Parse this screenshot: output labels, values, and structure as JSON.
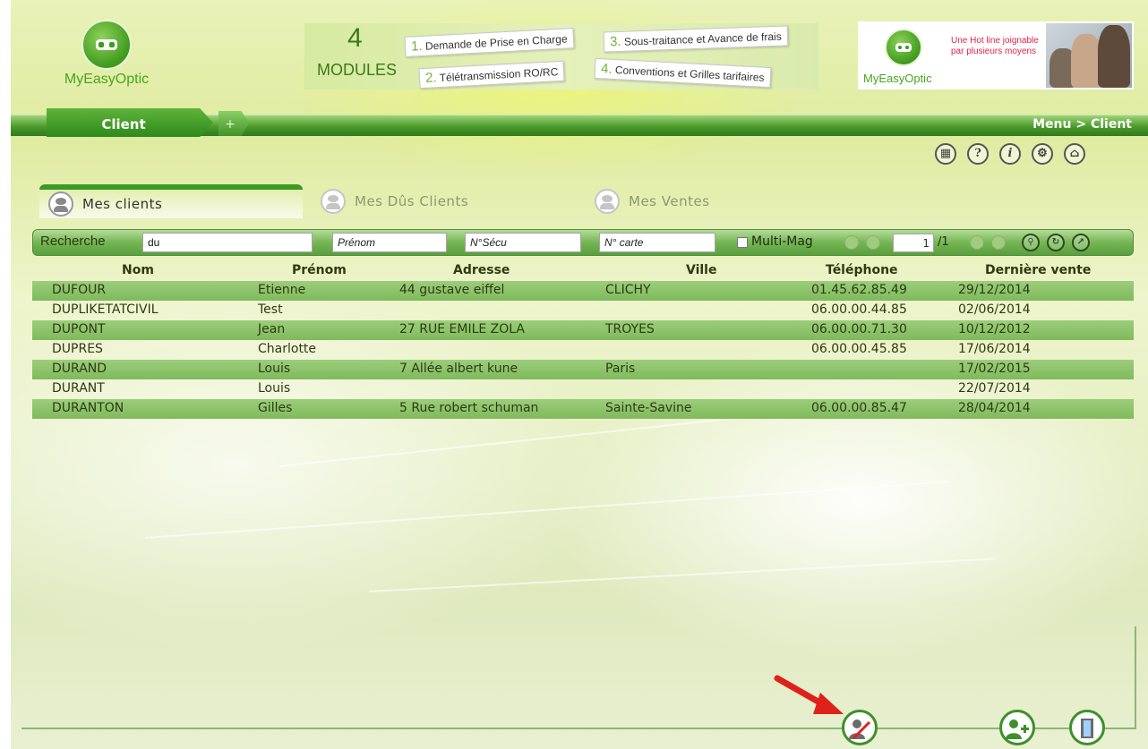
{
  "header": {
    "logo_text": "MyEasyOptic",
    "banner": {
      "number": "4",
      "modules": "MODULES",
      "items": [
        {
          "n": "1.",
          "label": "Demande de Prise en Charge"
        },
        {
          "n": "2.",
          "label": "Télétransmission RO/RC"
        },
        {
          "n": "3.",
          "label": "Sous-traitance et Avance de frais"
        },
        {
          "n": "4.",
          "label": "Conventions et Grilles tarifaires"
        }
      ]
    },
    "ad": {
      "brand": "MyEasyOptic",
      "line1": "Une Hot line joignable",
      "line2": "par plusieurs moyens"
    }
  },
  "tabs": {
    "active": "Client",
    "plus": "+",
    "breadcrumb": "Menu > Client"
  },
  "toolbar": {
    "icons": [
      "gift-icon",
      "help-icon",
      "info-icon",
      "settings-search-icon",
      "home-icon"
    ]
  },
  "subtabs": [
    {
      "label": "Mes clients",
      "active": true
    },
    {
      "label": "Mes Dûs Clients",
      "active": false
    },
    {
      "label": "Mes Ventes",
      "active": false
    }
  ],
  "search": {
    "label": "Recherche",
    "nom_value": "du",
    "prenom_placeholder": "Prénom",
    "secu_placeholder": "N°Sécu",
    "carte_placeholder": "N° carte",
    "multimag_label": "Multi-Mag",
    "page": "1",
    "total": "/1"
  },
  "table": {
    "headers": {
      "nom": "Nom",
      "prenom": "Prénom",
      "adresse": "Adresse",
      "ville": "Ville",
      "telephone": "Téléphone",
      "derniere_vente": "Dernière vente"
    },
    "rows": [
      {
        "nom": "DUFOUR",
        "prenom": "Etienne",
        "adresse": "44 gustave eiffel",
        "ville": "CLICHY",
        "tel": "01.45.62.85.49",
        "date": "29/12/2014"
      },
      {
        "nom": "DUPLIKETATCIVIL",
        "prenom": "Test",
        "adresse": "",
        "ville": "",
        "tel": "06.00.00.44.85",
        "date": "02/06/2014"
      },
      {
        "nom": "DUPONT",
        "prenom": "Jean",
        "adresse": "27 RUE EMILE ZOLA",
        "ville": "TROYES",
        "tel": "06.00.00.71.30",
        "date": "10/12/2012"
      },
      {
        "nom": "DUPRES",
        "prenom": "Charlotte",
        "adresse": "",
        "ville": "",
        "tel": "06.00.00.45.85",
        "date": "17/06/2014"
      },
      {
        "nom": "DURAND",
        "prenom": "Louis",
        "adresse": "7 Allée albert kune",
        "ville": "Paris",
        "tel": "",
        "date": "17/02/2015"
      },
      {
        "nom": "DURANT",
        "prenom": "Louis",
        "adresse": "",
        "ville": "",
        "tel": "",
        "date": "22/07/2014"
      },
      {
        "nom": "DURANTON",
        "prenom": "Gilles",
        "adresse": "5 Rue robert schuman",
        "ville": "Sainte-Savine",
        "tel": "06.00.00.85.47",
        "date": "28/04/2014"
      }
    ]
  },
  "footer": {
    "buttons": [
      "edit-client-icon",
      "add-client-icon",
      "exit-door-icon"
    ],
    "arrow_color": "#e0201b"
  },
  "colors": {
    "accent_green": "#3f9a1e",
    "row_green": "#8cc46a",
    "brand_red": "#e0224b"
  }
}
